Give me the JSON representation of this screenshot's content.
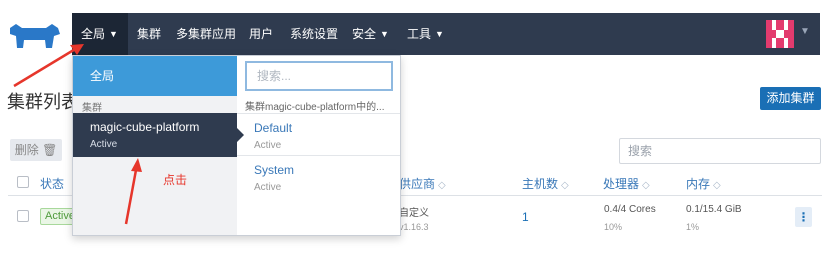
{
  "header": {
    "logo_icon": "rancher-cow-logo-icon",
    "nav": [
      {
        "label": "全局",
        "has_caret": true
      },
      {
        "label": "集群",
        "has_caret": false
      },
      {
        "label": "多集群应用",
        "has_caret": false
      },
      {
        "label": "用户",
        "has_caret": false
      },
      {
        "label": "系统设置",
        "has_caret": false
      },
      {
        "label": "安全",
        "has_caret": true
      },
      {
        "label": "工具",
        "has_caret": true
      }
    ],
    "avatar_icon": "user-avatar-icon"
  },
  "page": {
    "title": "集群列表",
    "add_button": "添加集群",
    "delete_button": "删除",
    "search_placeholder": "搜索"
  },
  "table": {
    "headers": {
      "status": "状态",
      "provider": "供应商",
      "nodes": "主机数",
      "cpu": "处理器",
      "memory": "内存"
    },
    "row": {
      "status": "Active",
      "provider": "自定义",
      "provider_version": "v1.16.3",
      "nodes": "1",
      "cpu": "0.4/4 Cores",
      "cpu_pct": "10%",
      "memory": "0.1/15.4 GiB",
      "memory_pct": "1%"
    }
  },
  "dropdown": {
    "global_label": "全局",
    "cluster_section": "集群",
    "cluster": {
      "name": "magic-cube-platform",
      "status": "Active"
    },
    "search_placeholder": "搜索...",
    "context_label": "集群magic-cube-platform中的...",
    "projects": [
      {
        "name": "Default",
        "status": "Active"
      },
      {
        "name": "System",
        "status": "Active"
      }
    ]
  },
  "annotation": {
    "text": "点击",
    "color": "#e6362b"
  },
  "colors": {
    "nav_bg": "#2f3b4f",
    "accent_blue": "#3d9ad9",
    "primary_button": "#1a6fb5",
    "active_badge": "#4f9b3c"
  }
}
